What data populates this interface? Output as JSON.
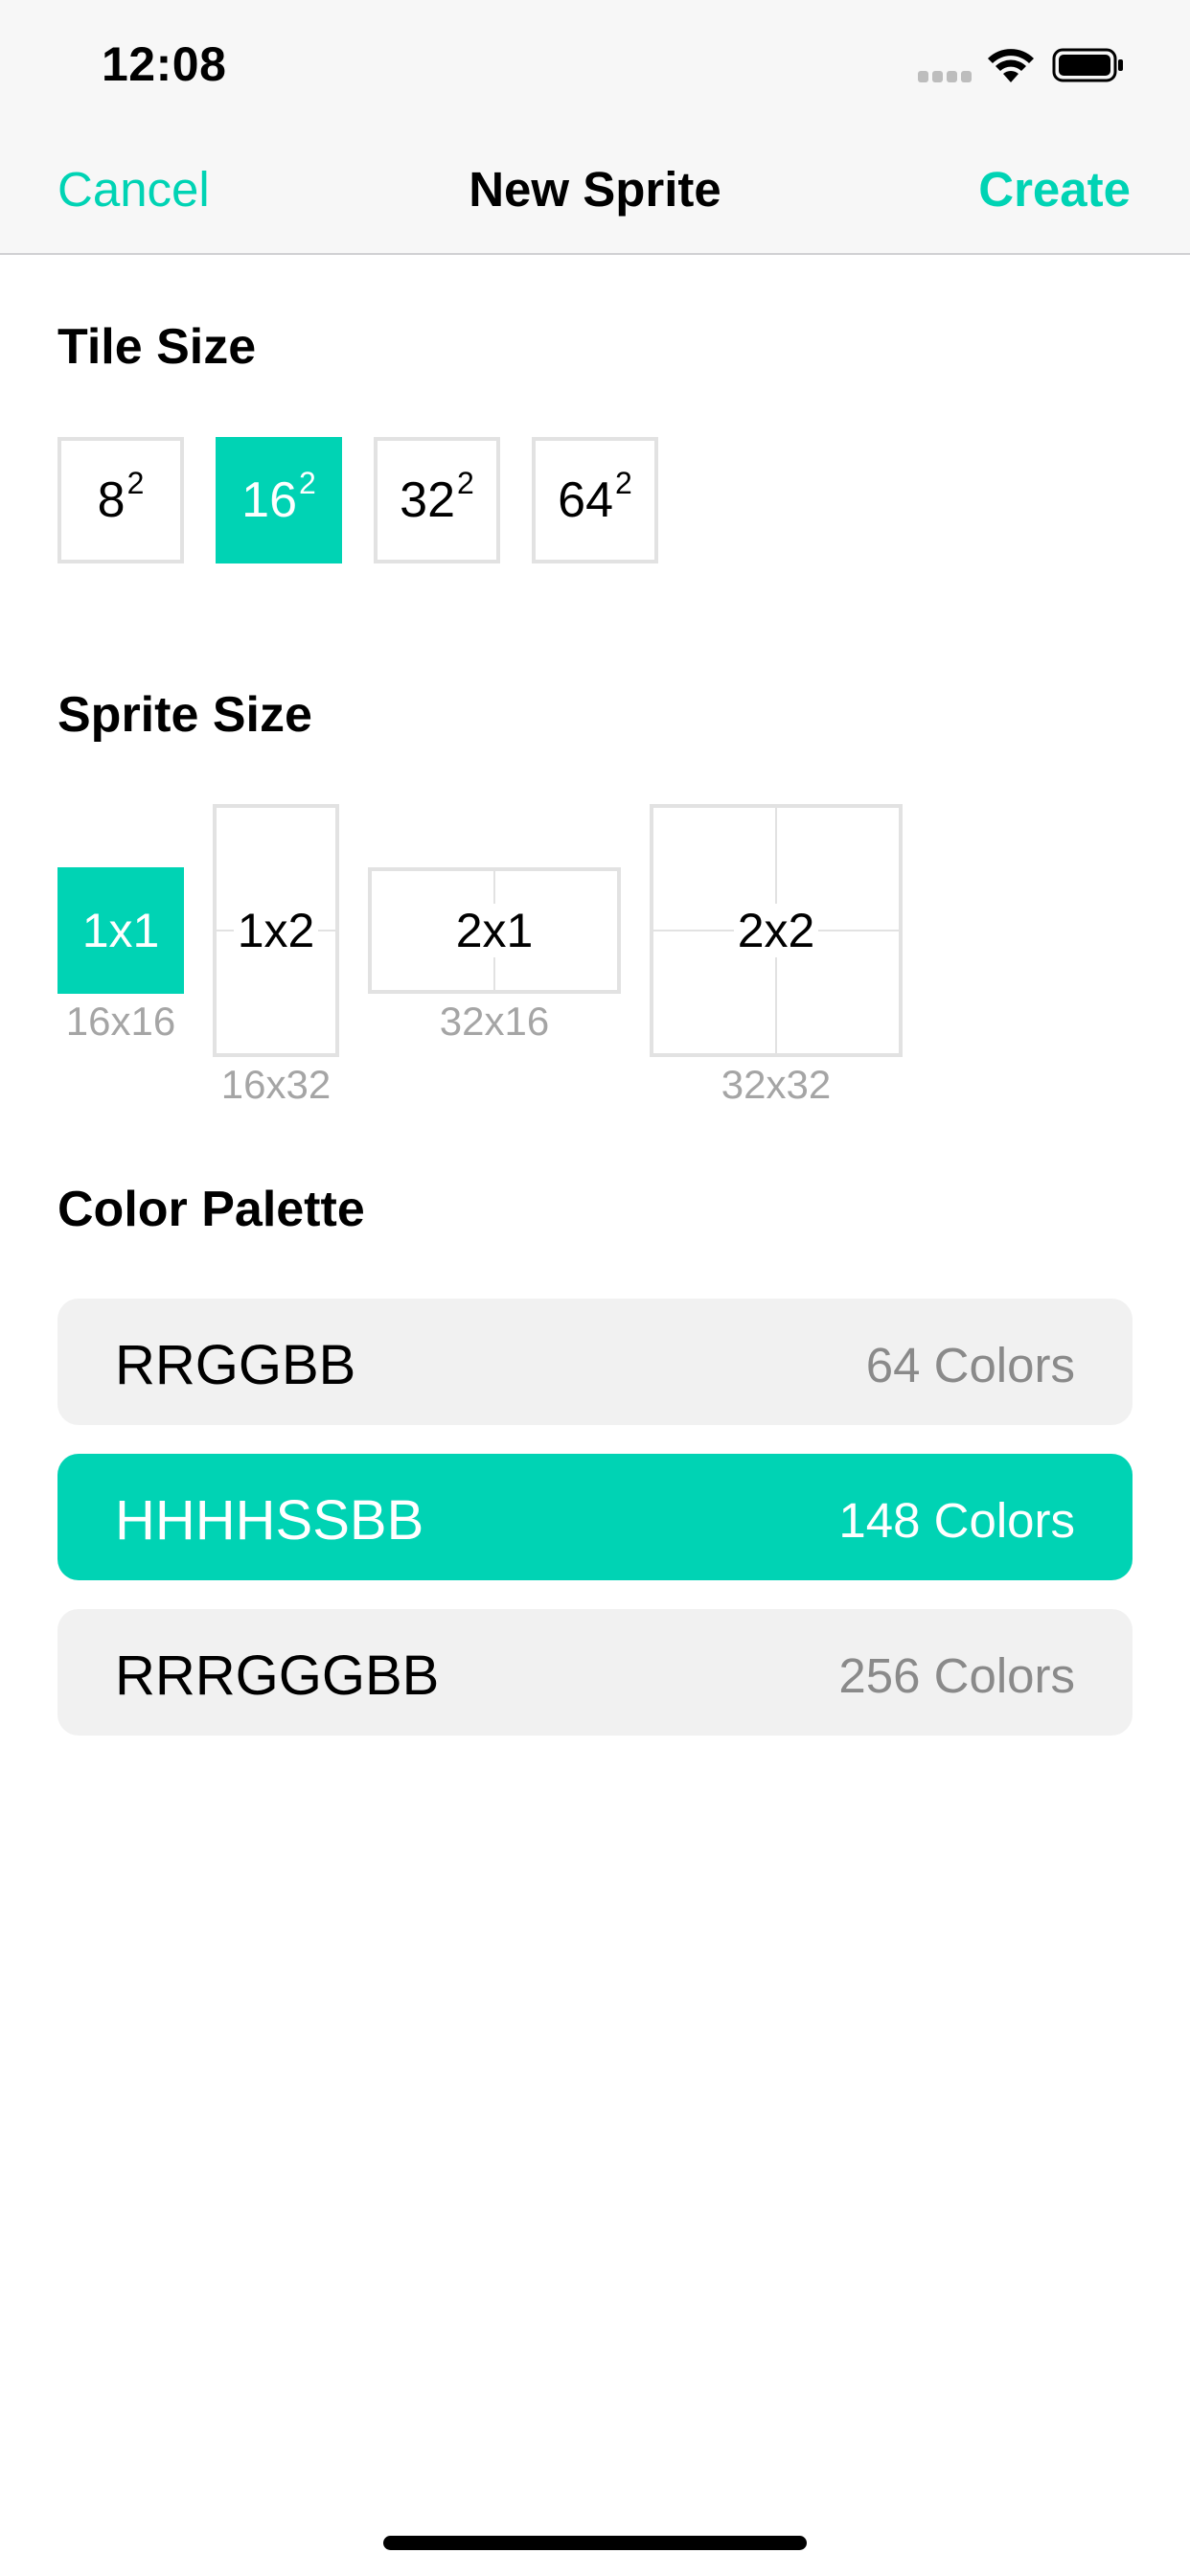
{
  "status_bar": {
    "time": "12:08",
    "icons": [
      "signal-icon",
      "wifi-icon",
      "battery-icon"
    ]
  },
  "nav": {
    "cancel_label": "Cancel",
    "title": "New Sprite",
    "create_label": "Create"
  },
  "accent_color": "#00d3b4",
  "tile_size": {
    "title": "Tile Size",
    "options": [
      {
        "base": "8",
        "exp": "2",
        "selected": false
      },
      {
        "base": "16",
        "exp": "2",
        "selected": true
      },
      {
        "base": "32",
        "exp": "2",
        "selected": false
      },
      {
        "base": "64",
        "exp": "2",
        "selected": false
      }
    ]
  },
  "sprite_size": {
    "title": "Sprite Size",
    "options": [
      {
        "label": "1x1",
        "pixels": "16x16",
        "selected": true
      },
      {
        "label": "1x2",
        "pixels": "16x32",
        "selected": false
      },
      {
        "label": "2x1",
        "pixels": "32x16",
        "selected": false
      },
      {
        "label": "2x2",
        "pixels": "32x32",
        "selected": false
      }
    ]
  },
  "color_palette": {
    "title": "Color Palette",
    "options": [
      {
        "name": "RRGGBB",
        "count": "64 Colors",
        "selected": false
      },
      {
        "name": "HHHHSSBB",
        "count": "148 Colors",
        "selected": true
      },
      {
        "name": "RRRGGGBB",
        "count": "256 Colors",
        "selected": false
      }
    ]
  }
}
